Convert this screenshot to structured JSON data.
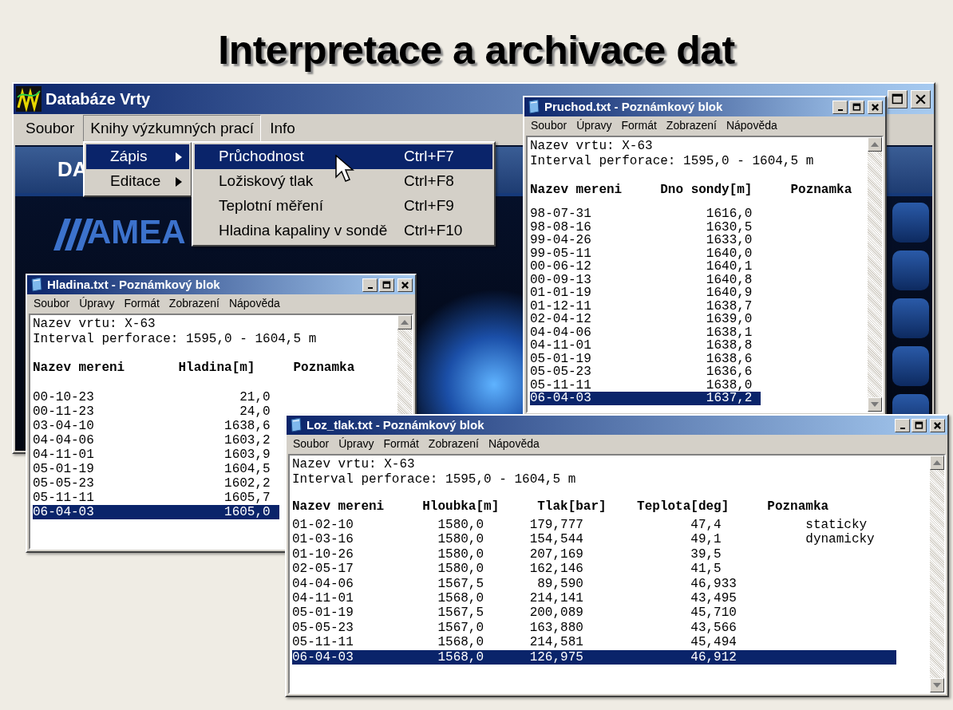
{
  "slide_title": "Interpretace a archivace dat",
  "main_window": {
    "title": "Databáze Vrty",
    "menu": [
      {
        "label": "Soubor",
        "selected": false
      },
      {
        "label": "Knihy výzkumných prací",
        "selected": true
      },
      {
        "label": "Info",
        "selected": false
      }
    ],
    "banner_texts": [
      "DA",
      "AMEA"
    ]
  },
  "submenu": [
    {
      "label": "Zápis",
      "selected": true,
      "has_submenu": true
    },
    {
      "label": "Editace",
      "selected": false,
      "has_submenu": true
    }
  ],
  "submenu_items": [
    {
      "label": "Průchodnost",
      "shortcut": "Ctrl+F7",
      "selected": true
    },
    {
      "label": "Ložiskový tlak",
      "shortcut": "Ctrl+F8",
      "selected": false
    },
    {
      "label": "Teplotní měření",
      "shortcut": "Ctrl+F9",
      "selected": false
    },
    {
      "label": "Hladina kapaliny v sondě",
      "shortcut": "Ctrl+F10",
      "selected": false
    }
  ],
  "notepads": [
    {
      "title": "Pruchod.txt - Poznámkový blok",
      "menu": [
        "Soubor",
        "Úpravy",
        "Formát",
        "Zobrazení",
        "Nápověda"
      ],
      "info_lines": [
        "Nazev vrtu: X-63",
        "Interval perforace: 1595,0 - 1604,5 m"
      ],
      "column_heading": "Nazev mereni     Dno sondy[m]     Poznamka",
      "rows": [
        {
          "text": "98-07-31               1616,0",
          "selected": false
        },
        {
          "text": "98-08-16               1630,5",
          "selected": false
        },
        {
          "text": "99-04-26               1633,0",
          "selected": false
        },
        {
          "text": "99-05-11               1640,0",
          "selected": false
        },
        {
          "text": "00-06-12               1640,1",
          "selected": false
        },
        {
          "text": "00-09-13               1640,8",
          "selected": false
        },
        {
          "text": "01-01-19               1640,9",
          "selected": false
        },
        {
          "text": "01-12-11               1638,7",
          "selected": false
        },
        {
          "text": "02-04-12               1639,0",
          "selected": false
        },
        {
          "text": "04-04-06               1638,1",
          "selected": false
        },
        {
          "text": "04-11-01               1638,8",
          "selected": false
        },
        {
          "text": "05-01-19               1638,6",
          "selected": false
        },
        {
          "text": "05-05-23               1636,6",
          "selected": false
        },
        {
          "text": "05-11-11               1638,0",
          "selected": false
        },
        {
          "text": "06-04-03               1637,2",
          "selected": true
        }
      ]
    },
    {
      "title": "Hladina.txt - Poznámkový blok",
      "menu": [
        "Soubor",
        "Úpravy",
        "Formát",
        "Zobrazení",
        "Nápověda"
      ],
      "info_lines": [
        "Nazev vrtu: X-63",
        "Interval perforace: 1595,0 - 1604,5 m"
      ],
      "column_heading": "Nazev mereni       Hladina[m]     Poznamka",
      "rows": [
        {
          "text": "00-10-23                   21,0",
          "selected": false
        },
        {
          "text": "00-11-23                   24,0",
          "selected": false
        },
        {
          "text": "03-04-10                 1638,6",
          "selected": false
        },
        {
          "text": "04-04-06                 1603,2",
          "selected": false
        },
        {
          "text": "04-11-01                 1603,9",
          "selected": false
        },
        {
          "text": "05-01-19                 1604,5",
          "selected": false
        },
        {
          "text": "05-05-23                 1602,2",
          "selected": false
        },
        {
          "text": "05-11-11                 1605,7",
          "selected": false
        },
        {
          "text": "06-04-03                 1605,0",
          "selected": true
        }
      ]
    },
    {
      "title": "Loz_tlak.txt - Poznámkový blok",
      "menu": [
        "Soubor",
        "Úpravy",
        "Formát",
        "Zobrazení",
        "Nápověda"
      ],
      "info_lines": [
        "Nazev vrtu: X-63",
        "Interval perforace: 1595,0 - 1604,5 m"
      ],
      "column_heading": "Nazev mereni     Hloubka[m]     Tlak[bar]    Teplota[deg]     Poznamka",
      "rows": [
        {
          "text": "01-02-10           1580,0      179,777              47,4           staticky",
          "selected": false
        },
        {
          "text": "01-03-16           1580,0      154,544              49,1           dynamicky",
          "selected": false
        },
        {
          "text": "01-10-26           1580,0      207,169              39,5",
          "selected": false
        },
        {
          "text": "02-05-17           1580,0      162,146              41,5",
          "selected": false
        },
        {
          "text": "04-04-06           1567,5       89,590              46,933",
          "selected": false
        },
        {
          "text": "04-11-01           1568,0      214,141              43,495",
          "selected": false
        },
        {
          "text": "05-01-19           1567,5      200,089              45,710",
          "selected": false
        },
        {
          "text": "05-05-23           1567,0      163,880              43,566",
          "selected": false
        },
        {
          "text": "05-11-11           1568,0      214,581              45,494",
          "selected": false
        },
        {
          "text": "06-04-03           1568,0      126,975              46,912",
          "selected": true
        }
      ]
    }
  ]
}
